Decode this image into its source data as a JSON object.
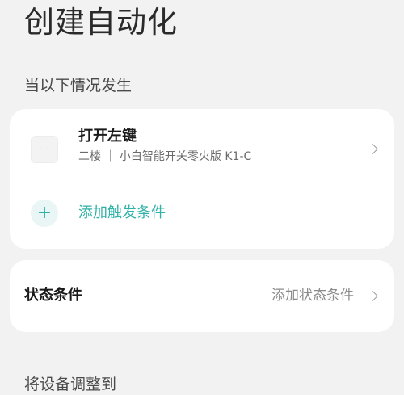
{
  "page": {
    "title": "创建自动化"
  },
  "trigger_section": {
    "heading": "当以下情况发生",
    "trigger": {
      "title": "打开左键",
      "subtitle": "二楼 ｜ 小白智能开关零火版 K1-C",
      "thumb_glyph": "···"
    },
    "add_trigger": {
      "icon": "+",
      "label": "添加触发条件"
    }
  },
  "condition_section": {
    "label": "状态条件",
    "action": "添加状态条件"
  },
  "action_section": {
    "heading": "将设备调整到"
  },
  "colors": {
    "accent": "#2fb2a7",
    "background": "#f2f2f2",
    "card": "#ffffff"
  },
  "icons": {
    "device": "device-thumbnail-icon",
    "add": "plus-icon",
    "chevron": "chevron-right-icon"
  }
}
